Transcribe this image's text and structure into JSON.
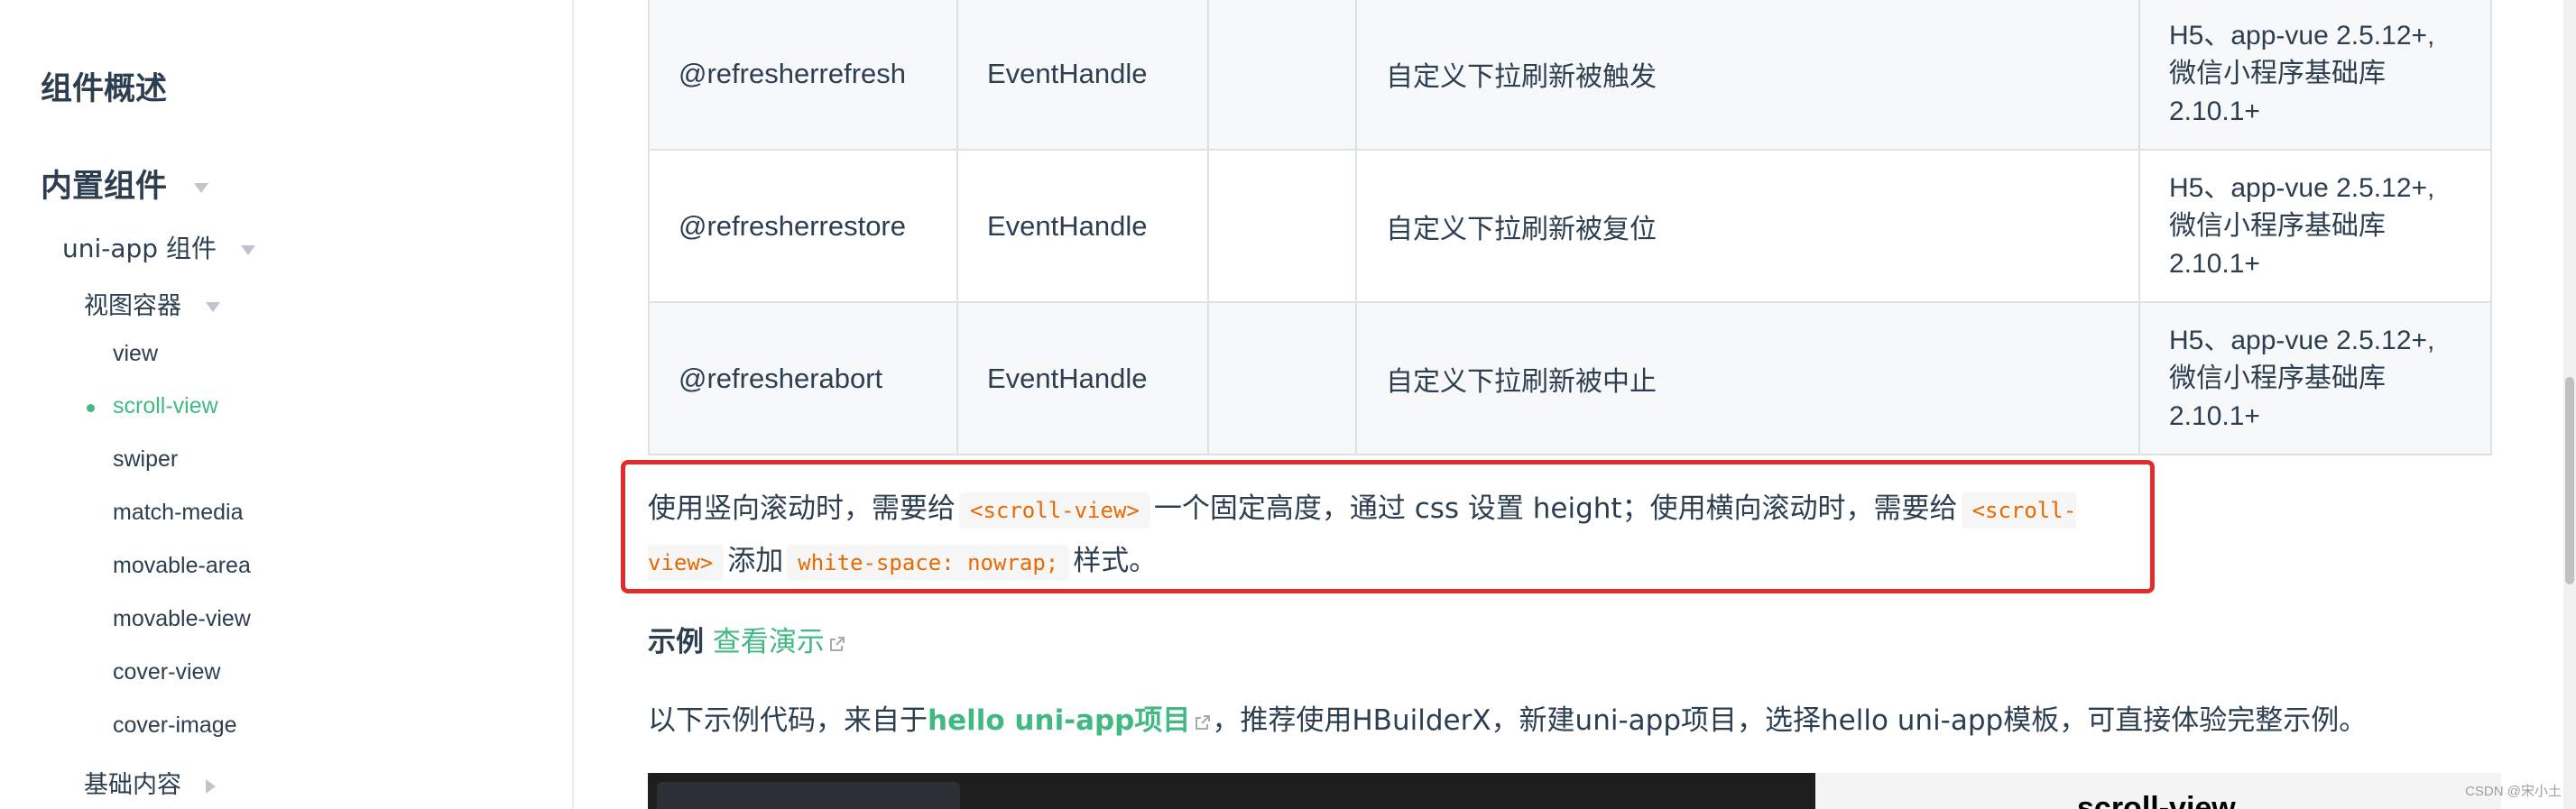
{
  "sidebar": {
    "overview": "组件概述",
    "builtin": "内置组件",
    "uniapp": "uni-app 组件",
    "view_container": "视图容器",
    "items": [
      "view",
      "scroll-view",
      "swiper",
      "match-media",
      "movable-area",
      "movable-view",
      "cover-view",
      "cover-image"
    ],
    "basic": "基础内容"
  },
  "events_table": {
    "rows": [
      {
        "name": "@refresherrefresh",
        "type": "EventHandle",
        "default": "",
        "desc": "自定义下拉刷新被触发",
        "platform": [
          "H5、app-vue 2.5.12+,",
          "微信小程序基础库",
          "2.10.1+"
        ]
      },
      {
        "name": "@refresherrestore",
        "type": "EventHandle",
        "default": "",
        "desc": "自定义下拉刷新被复位",
        "platform": [
          "H5、app-vue 2.5.12+,",
          "微信小程序基础库",
          "2.10.1+"
        ]
      },
      {
        "name": "@refresherabort",
        "type": "EventHandle",
        "default": "",
        "desc": "自定义下拉刷新被中止",
        "platform": [
          "H5、app-vue 2.5.12+,",
          "微信小程序基础库",
          "2.10.1+"
        ]
      }
    ]
  },
  "note": {
    "t1": "使用竖向滚动时，需要给",
    "code1": "<scroll-view>",
    "t2": "一个固定高度，通过 css 设置 height；使用横向滚动时，需要给",
    "code2": "<scroll-view>",
    "t3": "添加",
    "code3": "white-space: nowrap;",
    "t4": "样式。"
  },
  "example": {
    "title": "示例",
    "demo_link": "查看演示"
  },
  "intro": {
    "t1": "以下示例代码，来自于",
    "link": "hello uni-app项目",
    "t2": "，推荐使用HBuilderX，新建uni-app项目，选择hello uni-app模板，可直接体验完整示例。"
  },
  "demo": {
    "title": "scroll-view"
  },
  "watermark": "CSDN @宋小土",
  "colors": {
    "accent": "#42b983",
    "code": "#e96900",
    "highlight_border": "#e22b2b",
    "text": "#2c3e50"
  }
}
